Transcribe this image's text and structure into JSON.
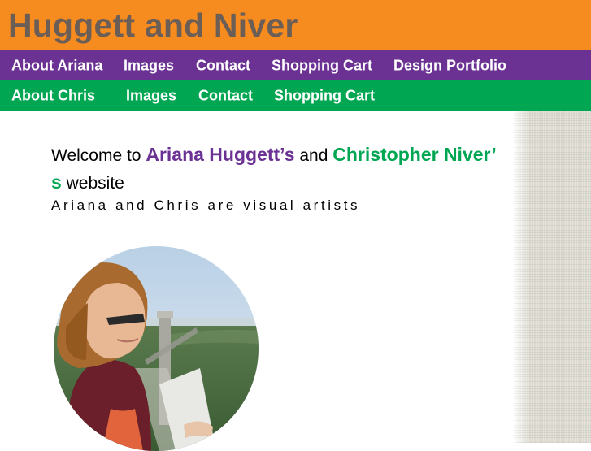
{
  "header": {
    "site_title": "Huggett and Niver"
  },
  "nav_ariana": {
    "items": [
      {
        "label": "About Ariana"
      },
      {
        "label": "Images"
      },
      {
        "label": "Contact"
      },
      {
        "label": "Shopping Cart"
      },
      {
        "label": "Design Portfolio"
      }
    ]
  },
  "nav_chris": {
    "items": [
      {
        "label": "About Chris"
      },
      {
        "label": "Images"
      },
      {
        "label": "Contact"
      },
      {
        "label": "Shopping Cart"
      }
    ]
  },
  "main": {
    "welcome_prefix": "Welcome to ",
    "ariana_name": "Ariana Huggett’s",
    "conjunction": " and ",
    "chris_name_part1": "Christopher Niver’",
    "chris_name_part2": "s",
    "welcome_suffix": " website",
    "tagline": "Ariana and Chris are visual artists"
  },
  "colors": {
    "header_orange": "#f68b1f",
    "title_gray": "#6b5e57",
    "ariana_purple": "#6b3294",
    "chris_green": "#00a651"
  }
}
